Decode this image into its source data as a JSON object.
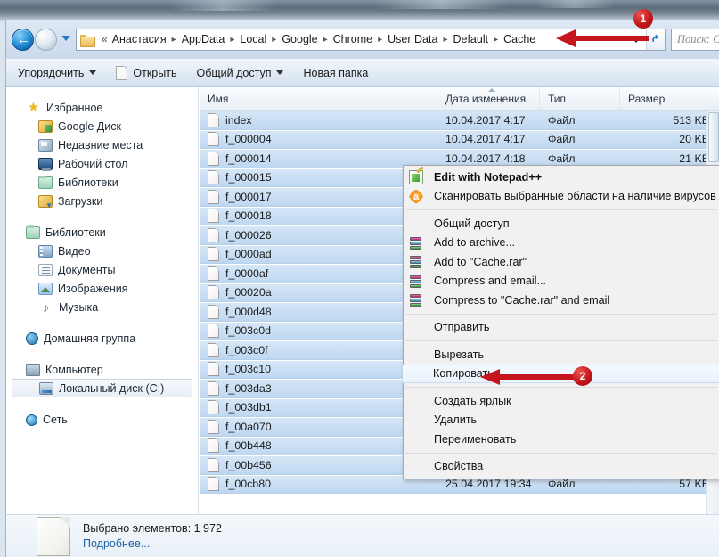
{
  "addressbar": {
    "back_label": "←",
    "breadcrumb_chevron": "«",
    "crumbs": [
      "Анастасия",
      "AppData",
      "Local",
      "Google",
      "Chrome",
      "User Data",
      "Default",
      "Cache"
    ],
    "separator": "▸",
    "search_placeholder": "Поиск: C"
  },
  "toolbar": {
    "items": [
      {
        "label": "Упорядочить",
        "caret": true,
        "icon": ""
      },
      {
        "label": "Открыть",
        "caret": false,
        "icon": "file-icon"
      },
      {
        "label": "Общий доступ",
        "caret": true,
        "icon": ""
      },
      {
        "label": "Новая папка",
        "caret": false,
        "icon": ""
      }
    ]
  },
  "sidebar": {
    "groups": [
      {
        "header": {
          "label": "Избранное",
          "icon": "star-icon"
        },
        "items": [
          {
            "label": "Google Диск",
            "icon": "google-drive-icon"
          },
          {
            "label": "Недавние места",
            "icon": "recent-places-icon"
          },
          {
            "label": "Рабочий стол",
            "icon": "desktop-icon"
          },
          {
            "label": "Библиотеки",
            "icon": "libraries-icon"
          },
          {
            "label": "Загрузки",
            "icon": "downloads-icon"
          }
        ]
      },
      {
        "header": {
          "label": "Библиотеки",
          "icon": "libraries-icon"
        },
        "items": [
          {
            "label": "Видео",
            "icon": "video-icon"
          },
          {
            "label": "Документы",
            "icon": "documents-icon"
          },
          {
            "label": "Изображения",
            "icon": "pictures-icon"
          },
          {
            "label": "Музыка",
            "icon": "music-icon"
          }
        ]
      },
      {
        "header": {
          "label": "Домашняя группа",
          "icon": "homegroup-icon"
        },
        "items": []
      },
      {
        "header": {
          "label": "Компьютер",
          "icon": "computer-icon"
        },
        "items": [
          {
            "label": "Локальный диск (C:)",
            "icon": "disk-icon",
            "selected": true
          }
        ]
      },
      {
        "header": {
          "label": "Сеть",
          "icon": "network-icon"
        },
        "items": []
      }
    ]
  },
  "filelist": {
    "columns": [
      {
        "label": "Имя",
        "sorted": false
      },
      {
        "label": "Дата изменения",
        "sorted": true
      },
      {
        "label": "Тип",
        "sorted": false
      },
      {
        "label": "Размер",
        "sorted": false
      }
    ],
    "rows": [
      {
        "name": "index",
        "date": "10.04.2017 4:17",
        "type": "Файл",
        "size": "513 KE"
      },
      {
        "name": "f_000004",
        "date": "10.04.2017 4:17",
        "type": "Файл",
        "size": "20 KE"
      },
      {
        "name": "f_000014",
        "date": "10.04.2017 4:18",
        "type": "Файл",
        "size": "21 KE"
      },
      {
        "name": "f_000015",
        "date": "",
        "type": "",
        "size": ""
      },
      {
        "name": "f_000017",
        "date": "",
        "type": "",
        "size": ""
      },
      {
        "name": "f_000018",
        "date": "",
        "type": "",
        "size": ""
      },
      {
        "name": "f_000026",
        "date": "",
        "type": "",
        "size": ""
      },
      {
        "name": "f_0000ad",
        "date": "",
        "type": "",
        "size": ""
      },
      {
        "name": "f_0000af",
        "date": "",
        "type": "",
        "size": ""
      },
      {
        "name": "f_00020a",
        "date": "",
        "type": "",
        "size": ""
      },
      {
        "name": "f_000d48",
        "date": "",
        "type": "",
        "size": ""
      },
      {
        "name": "f_003c0d",
        "date": "",
        "type": "",
        "size": ""
      },
      {
        "name": "f_003c0f",
        "date": "",
        "type": "",
        "size": ""
      },
      {
        "name": "f_003c10",
        "date": "",
        "type": "",
        "size": ""
      },
      {
        "name": "f_003da3",
        "date": "",
        "type": "",
        "size": ""
      },
      {
        "name": "f_003db1",
        "date": "",
        "type": "",
        "size": ""
      },
      {
        "name": "f_00a070",
        "date": "",
        "type": "",
        "size": ""
      },
      {
        "name": "f_00b448",
        "date": "",
        "type": "",
        "size": ""
      },
      {
        "name": "f_00b456",
        "date": "",
        "type": "",
        "size": ""
      },
      {
        "name": "f_00cb80",
        "date": "25.04.2017 19:34",
        "type": "Файл",
        "size": "57 KE"
      }
    ]
  },
  "contextmenu": {
    "items": [
      {
        "label": "Edit with Notepad++",
        "icon": "notepad-plus-plus-icon",
        "bold": true,
        "hovered": false
      },
      {
        "label": "Сканировать выбранные области на наличие вирусов",
        "icon": "avast-icon",
        "bold": false,
        "hovered": false
      },
      {
        "separator": true
      },
      {
        "label": "Общий доступ",
        "icon": "",
        "bold": false,
        "hovered": false
      },
      {
        "label": "Add to archive...",
        "icon": "winrar-icon",
        "bold": false,
        "hovered": false
      },
      {
        "label": "Add to \"Cache.rar\"",
        "icon": "winrar-icon",
        "bold": false,
        "hovered": false
      },
      {
        "label": "Compress and email...",
        "icon": "winrar-icon",
        "bold": false,
        "hovered": false
      },
      {
        "label": "Compress to \"Cache.rar\" and email",
        "icon": "winrar-icon",
        "bold": false,
        "hovered": false
      },
      {
        "separator": true
      },
      {
        "label": "Отправить",
        "icon": "",
        "bold": false,
        "hovered": false
      },
      {
        "separator": true
      },
      {
        "label": "Вырезать",
        "icon": "",
        "bold": false,
        "hovered": false
      },
      {
        "label": "Копировать",
        "icon": "",
        "bold": false,
        "hovered": true
      },
      {
        "separator": true
      },
      {
        "label": "Создать ярлык",
        "icon": "",
        "bold": false,
        "hovered": false
      },
      {
        "label": "Удалить",
        "icon": "",
        "bold": false,
        "hovered": false
      },
      {
        "label": "Переименовать",
        "icon": "",
        "bold": false,
        "hovered": false
      },
      {
        "separator": true
      },
      {
        "label": "Свойства",
        "icon": "",
        "bold": false,
        "hovered": false
      }
    ]
  },
  "statusbar": {
    "line1": "Выбрано элементов: 1 972",
    "line2": "Подробнее..."
  },
  "annotations": [
    {
      "number": "1",
      "target": "address-bar-cache-crumb"
    },
    {
      "number": "2",
      "target": "context-menu-copy-item"
    }
  ],
  "colors": {
    "annotation_red": "#c4161c",
    "selection_blue": "#cadff4",
    "link_blue": "#1f5fa8"
  }
}
